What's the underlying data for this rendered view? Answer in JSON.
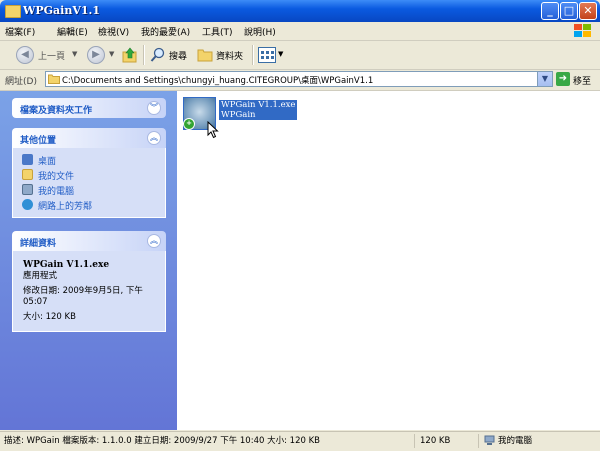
{
  "window": {
    "title": "WPGainV1.1"
  },
  "menu": [
    "檔案(F)",
    "編輯(E)",
    "檢視(V)",
    "我的最愛(A)",
    "工具(T)",
    "說明(H)"
  ],
  "toolbar": {
    "back_label": "上一頁",
    "search_label": "搜尋",
    "folders_label": "資料夾"
  },
  "address": {
    "label": "網址(D)",
    "path": "C:\\Documents and Settings\\chungyi_huang.CITEGROUP\\桌面\\WPGainV1.1",
    "go_label": "移至"
  },
  "tasks": {
    "file_folder_title": "檔案及資料夾工作",
    "other_places_title": "其他位置",
    "other_places": [
      "桌面",
      "我的文件",
      "我的電腦",
      "網路上的芳鄰"
    ],
    "details_title": "詳細資料",
    "details": {
      "file_name": "WPGain V1.1.exe",
      "file_type": "應用程式",
      "modified": "修改日期: 2009年9月5日, 下午 05:07",
      "size": "大小: 120 KB"
    }
  },
  "file": {
    "name": "WPGain V1.1.exe",
    "description": "WPGain"
  },
  "status": {
    "description": "描述: WPGain 檔案版本: 1.1.0.0 建立日期: 2009/9/27 下午 10:40 大小: 120 KB",
    "size": "120 KB",
    "zone": "我的電腦"
  },
  "colors": {
    "title_blue": "#0a5ae0",
    "selection": "#316ac5",
    "task_pane": "#6375d6"
  }
}
